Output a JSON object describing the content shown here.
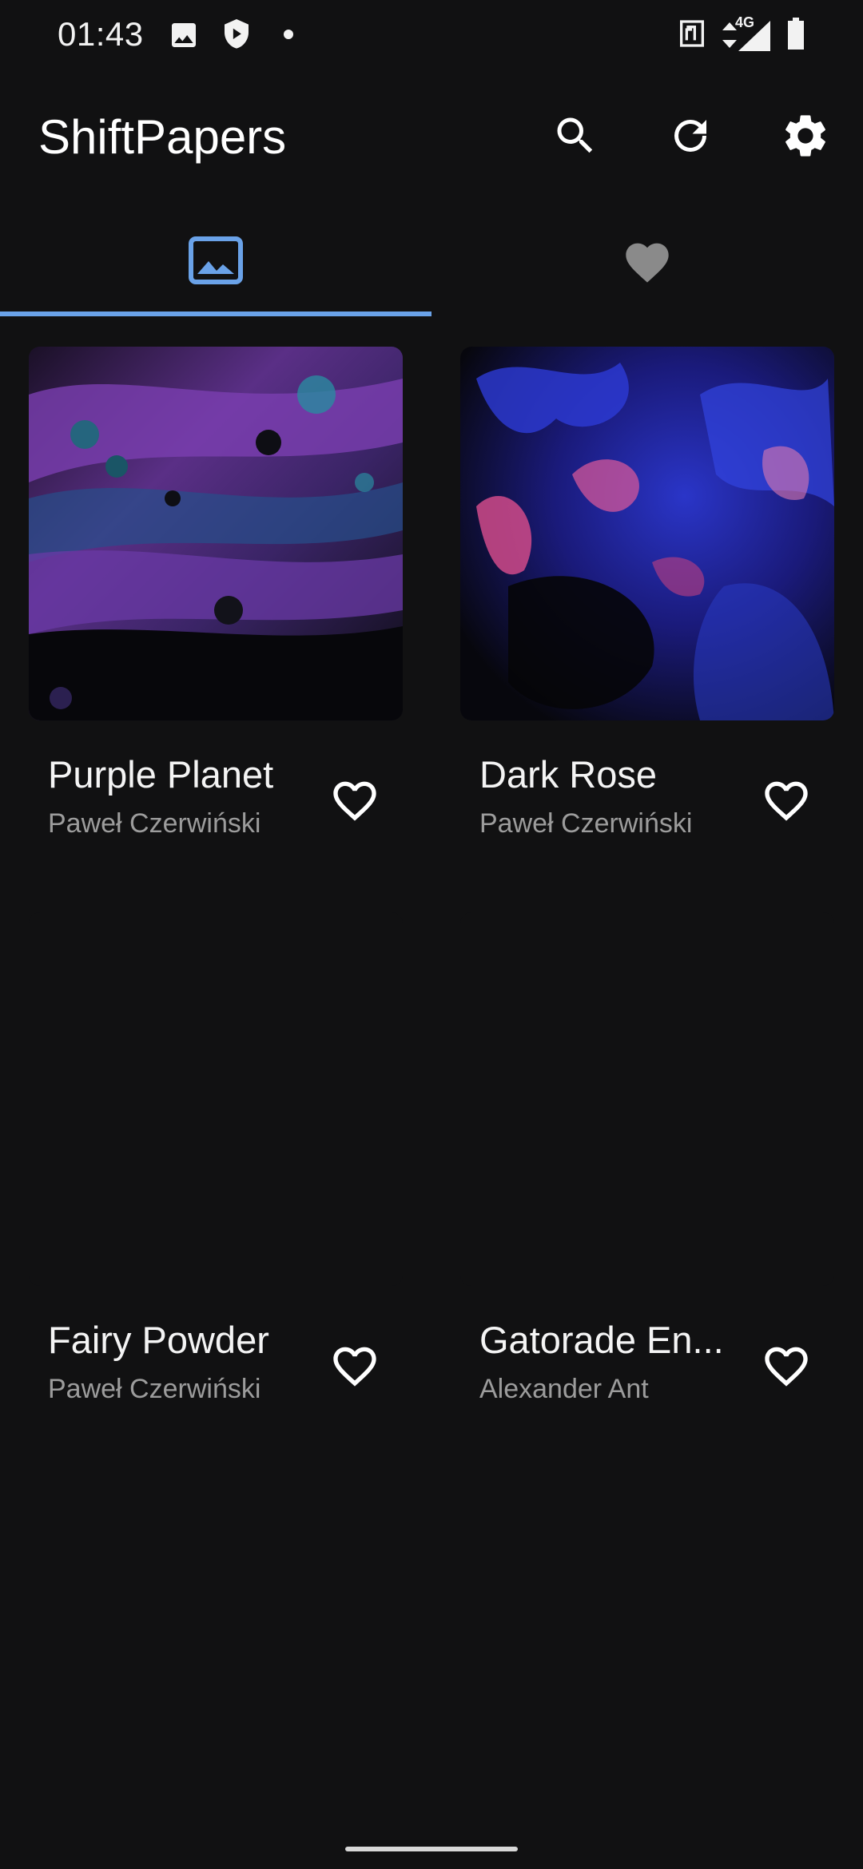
{
  "status_bar": {
    "time": "01:43",
    "network": "4G",
    "icons": [
      "image-icon",
      "shield-play-icon",
      "dot-icon",
      "nfc-icon",
      "data-arrows-icon",
      "signal-icon",
      "battery-icon"
    ]
  },
  "app_bar": {
    "title": "ShiftPapers",
    "actions": [
      "search-icon",
      "refresh-icon",
      "settings-icon"
    ]
  },
  "tabs": [
    {
      "icon": "wallpapers-icon",
      "selected": true
    },
    {
      "icon": "favorites-icon",
      "selected": false
    }
  ],
  "colors": {
    "background": "#111112",
    "accent": "#6aa2e8",
    "title_text": "#ffffff",
    "secondary_text": "#9c9c9c"
  },
  "wallpapers": [
    {
      "title": "Purple Planet",
      "author": "Paweł Czerwiński",
      "favorite": false
    },
    {
      "title": "Dark Rose",
      "author": "Paweł Czerwiński",
      "favorite": false
    },
    {
      "title": "Fairy Powder",
      "author": "Paweł Czerwiński",
      "favorite": false
    },
    {
      "title": "Gatorade En...",
      "author": "Alexander Ant",
      "favorite": false
    }
  ]
}
